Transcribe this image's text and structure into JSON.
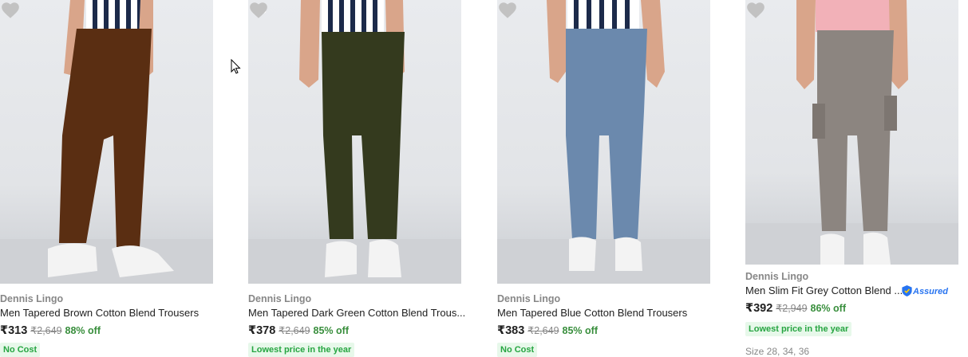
{
  "products": [
    {
      "brand": "Dennis Lingo",
      "title": "Men Tapered Brown Cotton Blend Trousers",
      "price": "₹313",
      "mrp": "₹2,649",
      "discount": "88% off",
      "tag": "No Cost",
      "pant_color": "#5a2e12",
      "shirt": "striped"
    },
    {
      "brand": "Dennis Lingo",
      "title": "Men Tapered Dark Green Cotton Blend Trous...",
      "price": "₹378",
      "mrp": "₹2,649",
      "discount": "85% off",
      "tag": "Lowest price in the year",
      "pant_color": "#343a1e",
      "shirt": "striped",
      "menu_label": "•••"
    },
    {
      "brand": "Dennis Lingo",
      "title": "Men Tapered Blue Cotton Blend Trousers",
      "price": "₹383",
      "mrp": "₹2,649",
      "discount": "85% off",
      "tag": "No Cost",
      "pant_color": "#6b89ad",
      "shirt": "striped"
    },
    {
      "brand": "Dennis Lingo",
      "title": "Men Slim Fit Grey Cotton Blend ...",
      "price": "₹392",
      "mrp": "₹2,949",
      "discount": "86% off",
      "tag": "Lowest price in the year",
      "assured_label": "Assured",
      "sizes": "Size 28, 34, 36",
      "pant_color": "#8c8580",
      "shirt": "pink"
    }
  ],
  "colors": {
    "wishlist_heart": "#c2c2c2",
    "discount_green": "#388e3c",
    "tag_bg": "#e7f8ea",
    "assured_blue": "#2874f0"
  }
}
